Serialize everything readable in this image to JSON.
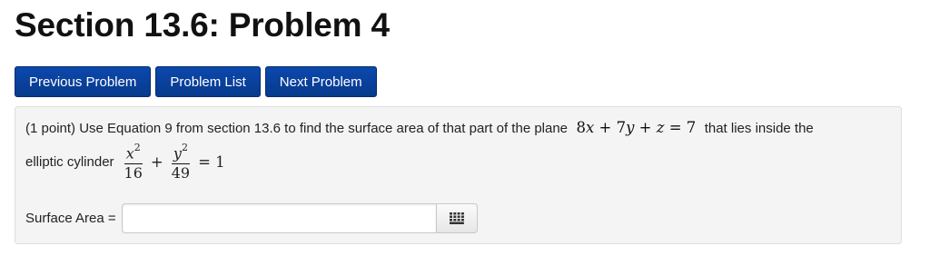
{
  "page": {
    "title": "Section 13.6: Problem 4"
  },
  "nav": {
    "previous_label": "Previous Problem",
    "list_label": "Problem List",
    "next_label": "Next Problem"
  },
  "problem": {
    "intro": "(1 point) Use Equation 9 from section 13.6 to find the surface area of that part of the plane",
    "plane_equation": "8x + 7y + z = 7",
    "tail": "that lies inside the",
    "line2_text": "elliptic cylinder",
    "ellipse": {
      "term1_numerator": "x",
      "term1_denominator": "16",
      "term2_numerator": "y",
      "term2_denominator": "49",
      "exponent": "2",
      "plus": "+",
      "rhs": "= 1"
    }
  },
  "answer": {
    "label": "Surface Area =",
    "value": "",
    "equation_editor_icon": "grid-keypad-icon"
  },
  "colors": {
    "nav_button_bg": "#0a3f99",
    "panel_bg": "#f4f4f4",
    "panel_border": "#dedede"
  }
}
